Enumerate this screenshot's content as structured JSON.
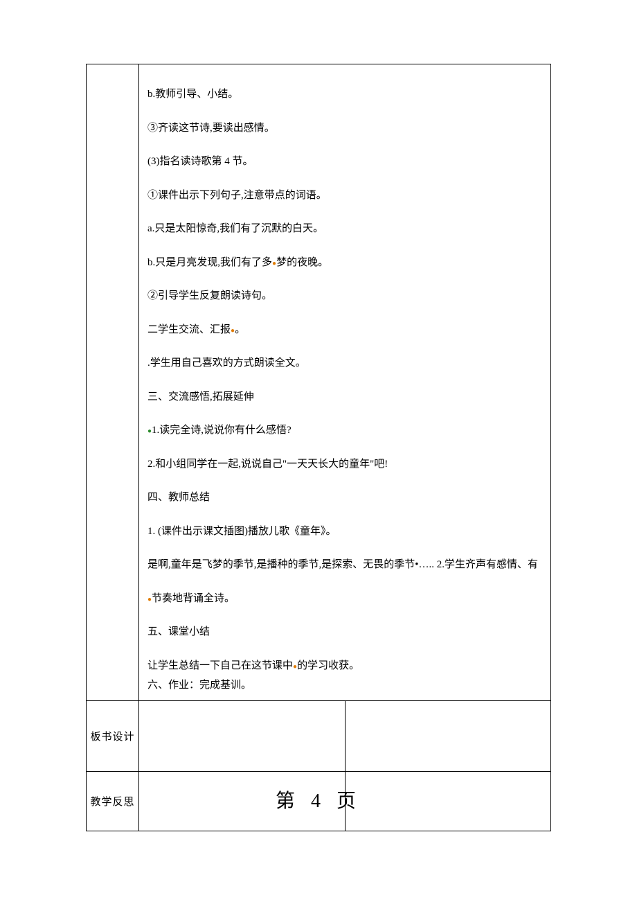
{
  "content": {
    "p1": "b.教师引导、小结。",
    "p2": "③齐读这节诗,要读出感情。",
    "p3": "(3)指名读诗歌第 4 节。",
    "p4_a": "①",
    "p4_kw": "课件",
    "p4_b": "出示下列句子,注意带点的词语。",
    "p5": "a.只是太阳惊奇,我们有了沉默的白天。",
    "p6_a": "b.只是月亮发现,我们有了多",
    "p6_b": "梦的夜晚。",
    "p7": "②引导学生反复朗读诗句。",
    "p8_a": "二学生交流、汇报",
    "p8_b": "。",
    "p9_a": ".",
    "p9_b": "学生用自己喜欢的方式朗读全文。",
    "p10": "三、交流感悟,拓展延伸",
    "p11_a": "1.读完全诗,说说你有什么感悟?",
    "p12": "2.和小组同学在一起,说说自己\"一天天长大的童年\"吧!",
    "p13": "四、教师总结",
    "p14": "1.  (课件出示课文插图)播放儿歌《童年》。",
    "p15": "是啊,童年是飞梦的季节,是播种的季节,是探索、无畏的季节•…..  2.学生齐声有感情、有",
    "p16_a": "节奏地背诵全诗。",
    "p17": "五、课堂小结",
    "p18_a": "让学生总结一下自己在这节课中",
    "p18_b": "的学习收获。",
    "p19": "六、作业：完成基训。"
  },
  "labels": {
    "board": "板书设计",
    "reflect": "教学反思"
  },
  "pageNumber": "第 4 页"
}
